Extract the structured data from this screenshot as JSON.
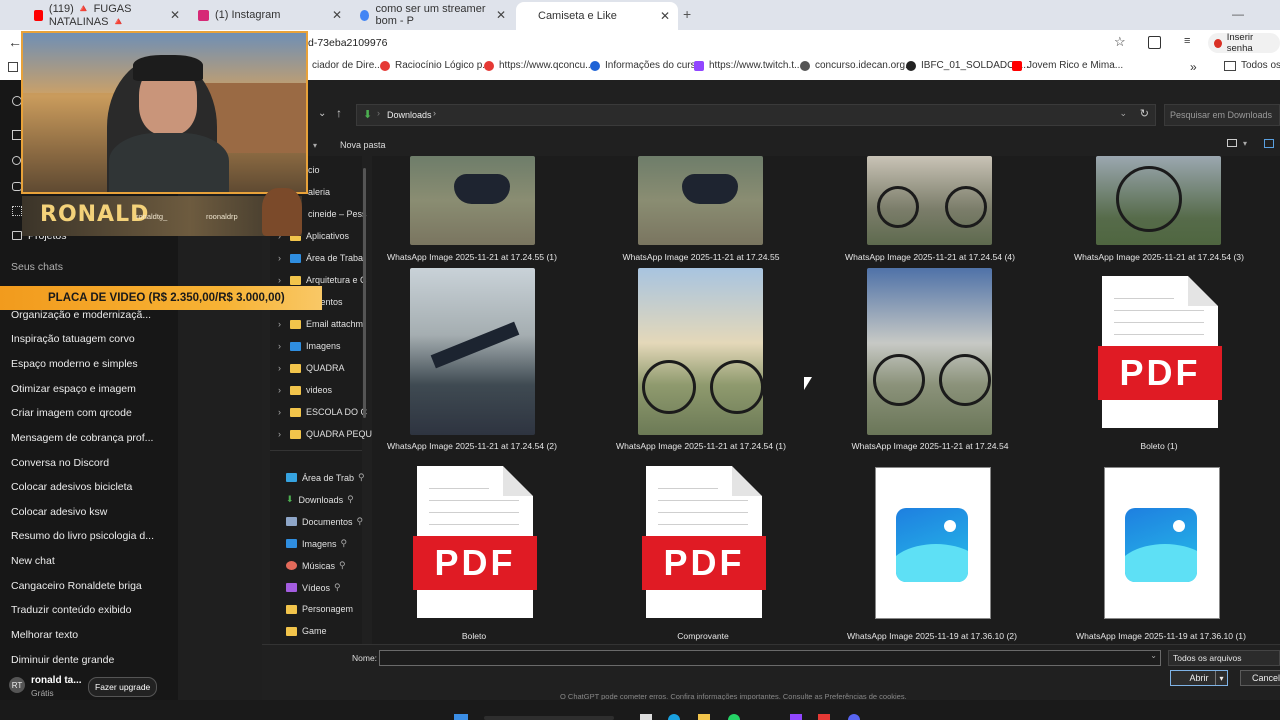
{
  "browser": {
    "tabs": [
      {
        "label": "(119) 🔺 FUGAS NATALINAS 🔺",
        "color": "#ff0000"
      },
      {
        "label": "(1) Instagram",
        "color": "#d62976"
      },
      {
        "label": "como ser um streamer bom - P",
        "color": "#4285f4"
      },
      {
        "label": "Camiseta e Like",
        "color": "#10a37f"
      }
    ],
    "new_tab": "+",
    "address": "d-73eba2109976",
    "password_button": "Inserir senha",
    "bookmarks": [
      {
        "label": "ciador de Dire..."
      },
      {
        "label": "Raciocínio Lógico p..."
      },
      {
        "label": "https://www.qconcu..."
      },
      {
        "label": "Informações do curso"
      },
      {
        "label": "https://www.twitch.t..."
      },
      {
        "label": "concurso.idecan.org..."
      },
      {
        "label": "IBFC_01_SOLDADO_..."
      },
      {
        "label": "Jovem Rico e Mima..."
      },
      {
        "label": "Todos os fa"
      }
    ]
  },
  "chat_sidebar": {
    "projects": "Projetos",
    "your_chats": "Seus chats",
    "chats": [
      "Organização e modernizaçã...",
      "Inspiração tatuagem corvo",
      "Espaço moderno e simples",
      "Otimizar espaço e imagem",
      "Criar imagem com qrcode",
      "Mensagem de cobrança prof...",
      "Conversa no Discord",
      "Colocar adesivos bicicleta",
      "Colocar adesivo ksw",
      "Resumo do livro psicologia d...",
      "New chat",
      "Cangaceiro Ronaldete briga",
      "Traduzir conteúdo exibido",
      "Melhorar texto",
      "Diminuir dente grande"
    ],
    "user_name": "ronald ta...",
    "user_plan": "Grátis",
    "upgrade": "Fazer upgrade"
  },
  "stream_overlay": {
    "streamer": "RONALD",
    "handle_1": "ronaldtg_",
    "handle_2": "roonaldrp",
    "banner": "PLACA DE VIDEO (R$ 2.350,00/R$ 3.000,00)"
  },
  "file_dialog": {
    "path": "Downloads",
    "search_placeholder": "Pesquisar em Downloads",
    "new_folder": "Nova pasta",
    "tree": [
      "cio",
      "aleria",
      "cineide – Pess",
      "Aplicativos",
      "Área de Trabal",
      "Arquitetura e C",
      "umentos",
      "Email attachm",
      "Imagens",
      "QUADRA",
      "videos",
      "ESCOLA DO C",
      "QUADRA PEQU"
    ],
    "quick_access": [
      "Área de Trab",
      "Downloads",
      "Documentos",
      "Imagens",
      "Músicas",
      "Vídeos",
      "Personagem",
      "Game"
    ],
    "files": [
      "WhatsApp Image 2025-11-21 at 17.24.55 (1)",
      "WhatsApp Image 2025-11-21 at 17.24.55",
      "WhatsApp Image 2025-11-21 at 17.24.54 (4)",
      "WhatsApp Image 2025-11-21 at 17.24.54 (3)",
      "WhatsApp Image 2025-11-21 at 17.24.54 (2)",
      "WhatsApp Image 2025-11-21 at 17.24.54 (1)",
      "WhatsApp Image 2025-11-21 at 17.24.54",
      "Boleto (1)",
      "Boleto",
      "Comprovante",
      "WhatsApp Image 2025-11-19 at 17.36.10 (2)",
      "WhatsApp Image 2025-11-19 at 17.36.10 (1)"
    ],
    "pdf_badge": "PDF",
    "name_label": "Nome:",
    "name_value": "",
    "filter": "Todos os arquivos",
    "open": "Abrir",
    "cancel": "Cancela",
    "footer_note": "O ChatGPT pode cometer erros. Confira informações importantes. Consulte as Preferências de cookies."
  }
}
